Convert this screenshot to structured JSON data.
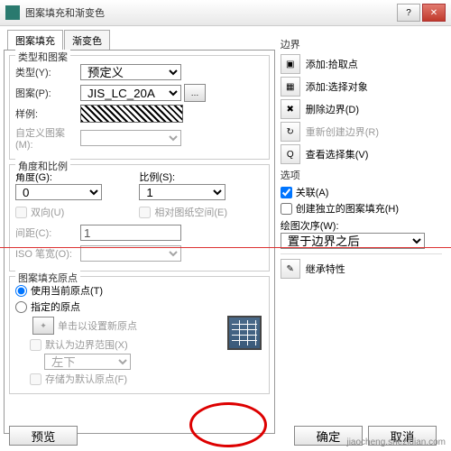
{
  "title": "图案填充和渐变色",
  "tabs": {
    "hatch": "图案填充",
    "gradient": "渐变色"
  },
  "type_pattern": {
    "title": "类型和图案",
    "type_label": "类型(Y):",
    "type_value": "预定义",
    "pattern_label": "图案(P):",
    "pattern_value": "JIS_LC_20A",
    "sample_label": "样例:",
    "custom_label": "自定义图案(M):"
  },
  "angle_scale": {
    "title": "角度和比例",
    "angle_label": "角度(G):",
    "angle_value": "0",
    "scale_label": "比例(S):",
    "scale_value": "1",
    "double_label": "双向(U)",
    "relative_label": "相对图纸空间(E)",
    "spacing_label": "间距(C):",
    "spacing_value": "1",
    "iso_label": "ISO 笔宽(O):"
  },
  "origin": {
    "title": "图案填充原点",
    "use_current": "使用当前原点(T)",
    "specified": "指定的原点",
    "click_set": "单击以设置新原点",
    "default_ext": "默认为边界范围(X)",
    "ext_value": "左下",
    "store_default": "存储为默认原点(F)"
  },
  "boundary": {
    "title": "边界",
    "add_pick": "添加:拾取点",
    "add_select": "添加:选择对象",
    "delete": "删除边界(D)",
    "recreate": "重新创建边界(R)",
    "view_sel": "查看选择集(V)"
  },
  "options": {
    "title": "选项",
    "assoc": "关联(A)",
    "independent": "创建独立的图案填充(H)",
    "draw_order_label": "绘图次序(W):",
    "draw_order_value": "置于边界之后"
  },
  "inherit": "继承特性",
  "buttons": {
    "preview": "预览",
    "ok": "确定",
    "cancel": "取消"
  },
  "watermark": "jiaocheng.shezidian.com"
}
